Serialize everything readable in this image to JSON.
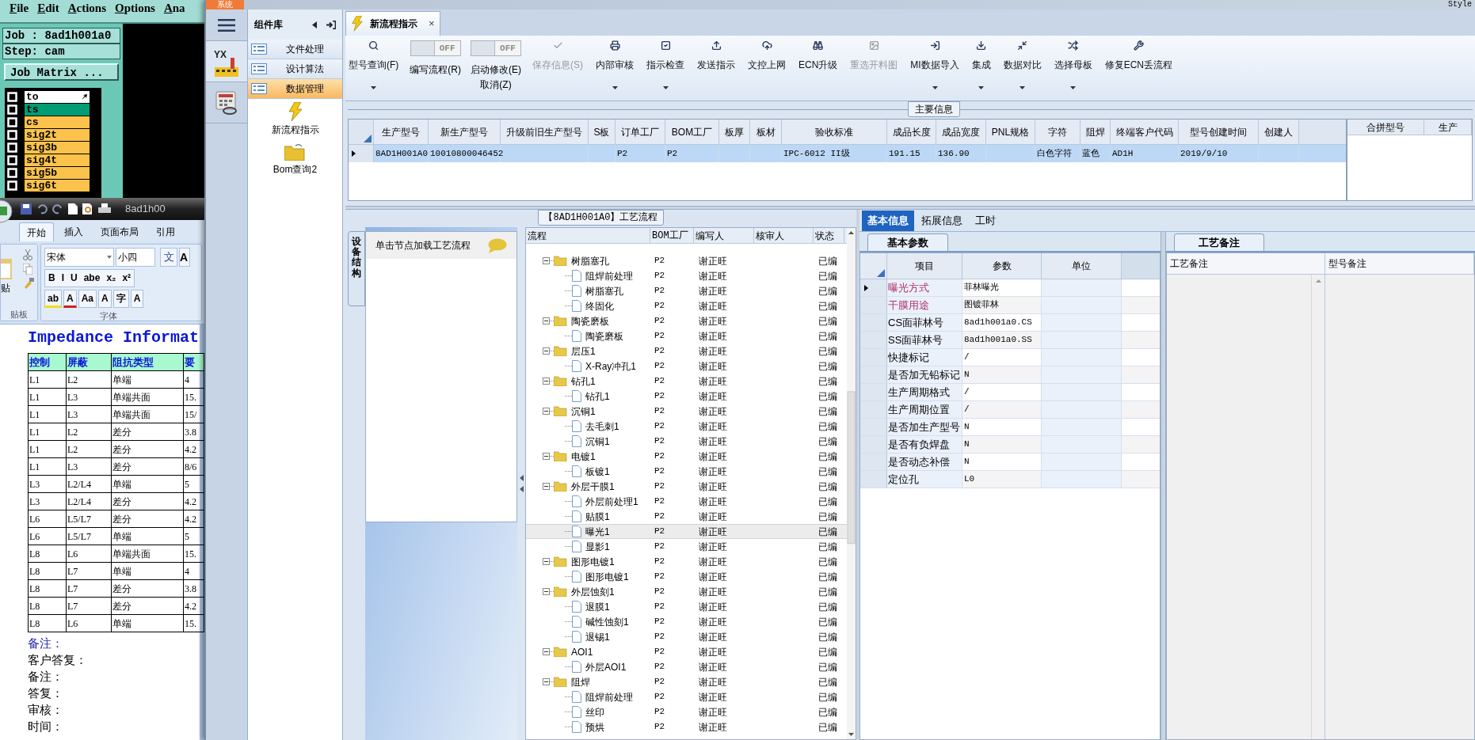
{
  "genesis": {
    "menu": [
      "File",
      "Edit",
      "Actions",
      "Options",
      "Ana"
    ],
    "job": "Job : 8ad1h001a0",
    "step": "Step: cam",
    "matrix_button": "Job Matrix ...",
    "layers": [
      {
        "name": "to",
        "color": "#ffffff"
      },
      {
        "name": "ts",
        "color": "#009c74"
      },
      {
        "name": "cs",
        "color": "#fcc34c"
      },
      {
        "name": "sig2t",
        "color": "#fcc34c"
      },
      {
        "name": "sig3b",
        "color": "#fcc34c"
      },
      {
        "name": "sig4t",
        "color": "#fcc34c"
      },
      {
        "name": "sig5b",
        "color": "#fcc34c"
      },
      {
        "name": "sig6t",
        "color": "#fcc34c"
      }
    ]
  },
  "word": {
    "doc_title": "8ad1h00",
    "tabs": [
      {
        "label": "开始",
        "selected": true
      },
      {
        "label": "插入",
        "selected": false
      },
      {
        "label": "页面布局",
        "selected": false
      },
      {
        "label": "引用",
        "selected": false
      }
    ],
    "paste_label": "贴",
    "font": "宋体",
    "size": "小四",
    "phonetic_button": "文",
    "grow_button": "A",
    "format_buttons": [
      "B",
      "I",
      "U",
      "abe",
      "x₂",
      "x²"
    ],
    "style_buttons": [
      "ab",
      "A",
      "Aa",
      "A",
      "字",
      "A"
    ],
    "groups": [
      "贴板",
      "字体"
    ],
    "heading": "Impedance Informat",
    "table": {
      "columns": [
        "控制",
        "屏蔽",
        "阻抗类型",
        "要"
      ],
      "rows": [
        [
          "L1",
          "L2",
          "单端",
          "4"
        ],
        [
          "L1",
          "L3",
          "单端共面",
          "15."
        ],
        [
          "L1",
          "L3",
          "单端共面",
          "15/"
        ],
        [
          "L1",
          "L2",
          "差分",
          "3.8"
        ],
        [
          "L1",
          "L2",
          "差分",
          "4.2"
        ],
        [
          "L1",
          "L3",
          "差分",
          "8/6"
        ],
        [
          "L3",
          "L2/L4",
          "单端",
          "5"
        ],
        [
          "L3",
          "L2/L4",
          "差分",
          "4.2"
        ],
        [
          "L6",
          "L5/L7",
          "差分",
          "4.2"
        ],
        [
          "L6",
          "L5/L7",
          "单端",
          "5"
        ],
        [
          "L8",
          "L6",
          "单端共面",
          "15."
        ],
        [
          "L8",
          "L7",
          "单端",
          "4"
        ],
        [
          "L8",
          "L7",
          "差分",
          "3.8"
        ],
        [
          "L8",
          "L7",
          "差分",
          "4.2"
        ],
        [
          "L8",
          "L6",
          "单端",
          "15."
        ]
      ]
    },
    "notes": [
      {
        "text": "备注：",
        "color": "#1a1aa0"
      },
      {
        "text": "客户答复：",
        "color": "#000000"
      },
      {
        "text": "备注：",
        "color": "#000000"
      },
      {
        "text": "答复：",
        "color": "#000000"
      },
      {
        "text": "审核：",
        "color": "#000000"
      },
      {
        "text": "时间：",
        "color": "#000000"
      }
    ]
  },
  "app": {
    "system_tab": "系统",
    "style_label": "Style",
    "logo_text": "YX",
    "component_library": {
      "title": "组件库",
      "categories": [
        {
          "label": "文件处理",
          "selected": false
        },
        {
          "label": "设计算法",
          "selected": false
        },
        {
          "label": "数据管理",
          "selected": true
        }
      ],
      "tools": [
        {
          "label": "新流程指示",
          "kind": "bolt"
        },
        {
          "label": "Bom查询2",
          "kind": "folder"
        }
      ]
    },
    "document_tab": {
      "title": "新流程指示",
      "close": "×"
    },
    "toolbar": [
      {
        "kind": "button",
        "label": "型号查询(F)",
        "dropdown": true,
        "disabled": false
      },
      {
        "kind": "toggle",
        "label": "编写流程(R)",
        "switch_text": "OFF",
        "on": false
      },
      {
        "kind": "toggle",
        "label": "启动修改(E)",
        "sublabel": "取消(Z)",
        "switch_text": "OFF",
        "on": false
      },
      {
        "kind": "button",
        "label": "保存信息(S)",
        "dropdown": false,
        "disabled": true
      },
      {
        "kind": "button",
        "label": "内部审核",
        "dropdown": true,
        "disabled": false
      },
      {
        "kind": "button",
        "label": "指示检查",
        "dropdown": true,
        "disabled": false
      },
      {
        "kind": "button",
        "label": "发送指示",
        "dropdown": false,
        "disabled": false
      },
      {
        "kind": "button",
        "label": "文控上网",
        "dropdown": false,
        "disabled": false
      },
      {
        "kind": "button",
        "label": "ECN升级",
        "dropdown": false,
        "disabled": false
      },
      {
        "kind": "button",
        "label": "重选开料图",
        "dropdown": false,
        "disabled": true
      },
      {
        "kind": "button",
        "label": "MI数据导入",
        "dropdown": true,
        "disabled": false
      },
      {
        "kind": "button",
        "label": "集成",
        "dropdown": true,
        "disabled": false
      },
      {
        "kind": "button",
        "label": "数据对比",
        "dropdown": true,
        "disabled": false
      },
      {
        "kind": "button",
        "label": "选择母板",
        "dropdown": true,
        "disabled": false
      },
      {
        "kind": "button",
        "label": "修复ECN丢流程",
        "dropdown": false,
        "disabled": false
      }
    ],
    "main_info": {
      "title": "主要信息",
      "columns": [
        "生产型号",
        "新生产型号",
        "升级前旧生产型号",
        "S板",
        "订单工厂",
        "BOM工厂",
        "板厚",
        "板材",
        "验收标准",
        "成品长度",
        "成品宽度",
        "PNL规格",
        "字符",
        "阻焊",
        "终端客户代码",
        "型号创建时间",
        "创建人"
      ],
      "rows": [
        {
          "selected": true,
          "cells": [
            "8AD1H001A0",
            "10010800046452",
            null,
            null,
            "P2",
            "P2",
            null,
            null,
            "IPC-6012 II级",
            "191.15",
            "136.90",
            null,
            "白色字符",
            "蓝色",
            "AD1H",
            "2019/9/10",
            null
          ]
        }
      ],
      "merge_columns": [
        "合拼型号",
        "生产"
      ]
    },
    "process": {
      "title": "【8AD1H001A0】工艺流程",
      "side_tab": "设备结构",
      "hint": "单击节点加载工艺流程",
      "columns": [
        "流程",
        "BOM工厂",
        "编写人",
        "核审人",
        "状态"
      ],
      "tree": [
        {
          "name": "树脂塞孔",
          "bom_factory": "P2",
          "writer": "谢正旺",
          "status": "已编",
          "selected": false,
          "expanded": true,
          "children": [
            {
              "name": "阻焊前处理",
              "bom_factory": "P2",
              "writer": "谢正旺",
              "status": "已编",
              "selected": false
            },
            {
              "name": "树脂塞孔",
              "bom_factory": "P2",
              "writer": "谢正旺",
              "status": "已编",
              "selected": false
            },
            {
              "name": "终固化",
              "bom_factory": "P2",
              "writer": "谢正旺",
              "status": "已编",
              "selected": false
            }
          ]
        },
        {
          "name": "陶瓷磨板",
          "bom_factory": "P2",
          "writer": "谢正旺",
          "status": "已编",
          "selected": false,
          "expanded": true,
          "children": [
            {
              "name": "陶瓷磨板",
              "bom_factory": "P2",
              "writer": "谢正旺",
              "status": "已编",
              "selected": false
            }
          ]
        },
        {
          "name": "层压1",
          "bom_factory": "P2",
          "writer": "谢正旺",
          "status": "已编",
          "selected": false,
          "expanded": true,
          "children": [
            {
              "name": "X-Ray冲孔1",
              "bom_factory": "P2",
              "writer": "谢正旺",
              "status": "已编",
              "selected": false
            }
          ]
        },
        {
          "name": "钻孔1",
          "bom_factory": "P2",
          "writer": "谢正旺",
          "status": "已编",
          "selected": false,
          "expanded": true,
          "children": [
            {
              "name": "钻孔1",
              "bom_factory": "P2",
              "writer": "谢正旺",
              "status": "已编",
              "selected": false
            }
          ]
        },
        {
          "name": "沉铜1",
          "bom_factory": "P2",
          "writer": "谢正旺",
          "status": "已编",
          "selected": false,
          "expanded": true,
          "children": [
            {
              "name": "去毛刺1",
              "bom_factory": "P2",
              "writer": "谢正旺",
              "status": "已编",
              "selected": false
            },
            {
              "name": "沉铜1",
              "bom_factory": "P2",
              "writer": "谢正旺",
              "status": "已编",
              "selected": false
            }
          ]
        },
        {
          "name": "电镀1",
          "bom_factory": "P2",
          "writer": "谢正旺",
          "status": "已编",
          "selected": false,
          "expanded": true,
          "children": [
            {
              "name": "板镀1",
              "bom_factory": "P2",
              "writer": "谢正旺",
              "status": "已编",
              "selected": false
            }
          ]
        },
        {
          "name": "外层干膜1",
          "bom_factory": "P2",
          "writer": "谢正旺",
          "status": "已编",
          "selected": false,
          "expanded": true,
          "children": [
            {
              "name": "外层前处理1",
              "bom_factory": "P2",
              "writer": "谢正旺",
              "status": "已编",
              "selected": false
            },
            {
              "name": "贴膜1",
              "bom_factory": "P2",
              "writer": "谢正旺",
              "status": "已编",
              "selected": false
            },
            {
              "name": "曝光1",
              "bom_factory": "P2",
              "writer": "谢正旺",
              "status": "已编",
              "selected": true
            },
            {
              "name": "显影1",
              "bom_factory": "P2",
              "writer": "谢正旺",
              "status": "已编",
              "selected": false
            }
          ]
        },
        {
          "name": "图形电镀1",
          "bom_factory": "P2",
          "writer": "谢正旺",
          "status": "已编",
          "selected": false,
          "expanded": true,
          "children": [
            {
              "name": "图形电镀1",
              "bom_factory": "P2",
              "writer": "谢正旺",
              "status": "已编",
              "selected": false
            }
          ]
        },
        {
          "name": "外层蚀刻1",
          "bom_factory": "P2",
          "writer": "谢正旺",
          "status": "已编",
          "selected": false,
          "expanded": true,
          "children": [
            {
              "name": "退膜1",
              "bom_factory": "P2",
              "writer": "谢正旺",
              "status": "已编",
              "selected": false
            },
            {
              "name": "碱性蚀刻1",
              "bom_factory": "P2",
              "writer": "谢正旺",
              "status": "已编",
              "selected": false
            },
            {
              "name": "退锡1",
              "bom_factory": "P2",
              "writer": "谢正旺",
              "status": "已编",
              "selected": false
            }
          ]
        },
        {
          "name": "AOI1",
          "bom_factory": "P2",
          "writer": "谢正旺",
          "status": "已编",
          "selected": false,
          "expanded": true,
          "children": [
            {
              "name": "外层AOI1",
              "bom_factory": "P2",
              "writer": "谢正旺",
              "status": "已编",
              "selected": false
            }
          ]
        },
        {
          "name": "阻焊",
          "bom_factory": "P2",
          "writer": "谢正旺",
          "status": "已编",
          "selected": false,
          "expanded": true,
          "children": [
            {
              "name": "阻焊前处理",
              "bom_factory": "P2",
              "writer": "谢正旺",
              "status": "已编",
              "selected": false
            },
            {
              "name": "丝印",
              "bom_factory": "P2",
              "writer": "谢正旺",
              "status": "已编",
              "selected": false
            },
            {
              "name": "预烘",
              "bom_factory": "P2",
              "writer": "谢正旺",
              "status": "已编",
              "selected": false
            }
          ]
        }
      ]
    },
    "detail": {
      "tabs": [
        {
          "label": "基本信息",
          "selected": true
        },
        {
          "label": "拓展信息",
          "selected": false
        },
        {
          "label": "工时",
          "selected": false
        }
      ],
      "params_tab": "基本参数",
      "columns": [
        "项目",
        "参数",
        "单位"
      ],
      "params": [
        {
          "item": "曝光方式",
          "value": "菲林曝光",
          "highlighted": true,
          "selected": true
        },
        {
          "item": "干膜用途",
          "value": "图镀菲林",
          "highlighted": true,
          "selected": false
        },
        {
          "item": "CS面菲林号",
          "value": "8ad1h001a0.CS",
          "highlighted": false,
          "selected": false
        },
        {
          "item": "SS面菲林号",
          "value": "8ad1h001a0.SS",
          "highlighted": false,
          "selected": false
        },
        {
          "item": "快捷标记",
          "value": "/",
          "highlighted": false,
          "selected": false
        },
        {
          "item": "是否加无铅标记",
          "value": "N",
          "highlighted": false,
          "selected": false
        },
        {
          "item": "生产周期格式",
          "value": "/",
          "highlighted": false,
          "selected": false
        },
        {
          "item": "生产周期位置",
          "value": "/",
          "highlighted": false,
          "selected": false
        },
        {
          "item": "是否加生产型号",
          "value": "N",
          "highlighted": false,
          "selected": false
        },
        {
          "item": "是否有负焊盘",
          "value": "N",
          "highlighted": false,
          "selected": false
        },
        {
          "item": "是否动态补偿",
          "value": "N",
          "highlighted": false,
          "selected": false
        },
        {
          "item": "定位孔",
          "value": "L0",
          "highlighted": false,
          "selected": false
        }
      ],
      "notes_tab": "工艺备注",
      "notes_columns": [
        "工艺备注",
        "型号备注"
      ]
    }
  }
}
